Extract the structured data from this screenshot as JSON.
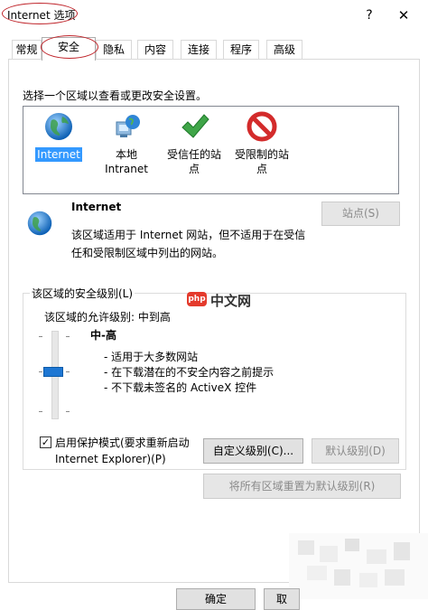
{
  "window": {
    "title": "Internet 选项",
    "help_glyph": "?",
    "close_glyph": "✕"
  },
  "tabs": [
    {
      "label": "常规"
    },
    {
      "label": "安全"
    },
    {
      "label": "隐私"
    },
    {
      "label": "内容"
    },
    {
      "label": "连接"
    },
    {
      "label": "程序"
    },
    {
      "label": "高级"
    }
  ],
  "security": {
    "zone_prompt": "选择一个区域以查看或更改安全设置。",
    "zones": [
      {
        "label": "Internet",
        "icon": "globe-icon",
        "selected": true
      },
      {
        "label": "本地\nIntranet",
        "icon": "local-intranet-icon",
        "selected": false
      },
      {
        "label": "受信任的站\n点",
        "icon": "checkmark-icon",
        "selected": false
      },
      {
        "label": "受限制的站\n点",
        "icon": "no-entry-icon",
        "selected": false
      }
    ],
    "zone_title": "Internet",
    "zone_desc": "该区域适用于 Internet 网站，但不适用于在受信任和受限制区域中列出的网站。",
    "sites_button": "站点(S)",
    "group_label": "该区域的安全级别(L)",
    "allowed_levels": "该区域的允许级别: 中到高",
    "level_name": "中-高",
    "level_bullets": [
      "- 适用于大多数网站",
      "- 在下载潜在的不安全内容之前提示",
      "- 不下载未签名的 ActiveX 控件"
    ],
    "slider_level": "中-高",
    "protected_mode_label": "启用保护模式(要求重新启动 Internet Explorer)(P)",
    "protected_mode_checked": true,
    "custom_level_button": "自定义级别(C)...",
    "default_level_button": "默认级别(D)",
    "reset_all_button": "将所有区域重置为默认级别(R)"
  },
  "footer": {
    "ok_button": "确定",
    "cancel_button_partial": "取"
  },
  "watermark": {
    "logo_text": "php",
    "site_text": "中文网"
  },
  "colors": {
    "selection": "#3399ff",
    "annotation_ring": "#c0262c",
    "slider_thumb": "#1e77d3"
  }
}
